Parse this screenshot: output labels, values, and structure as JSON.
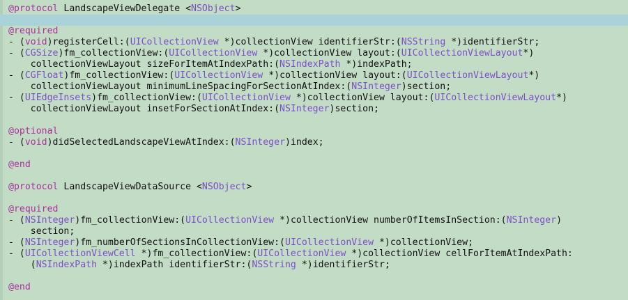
{
  "editor": {
    "current_line_index": 1,
    "colors": {
      "background": "#c3dcc6",
      "current_line": "#a9d3d9",
      "keyword": "#a8329a",
      "type": "#7b4fc4",
      "plain": "#111111"
    },
    "lines": [
      [
        {
          "t": "kw",
          "s": "@protocol"
        },
        {
          "t": "plain",
          "s": " LandscapeViewDelegate <"
        },
        {
          "t": "type",
          "s": "NSObject"
        },
        {
          "t": "plain",
          "s": ">"
        }
      ],
      [],
      [
        {
          "t": "kw",
          "s": "@required"
        }
      ],
      [
        {
          "t": "plain",
          "s": "- ("
        },
        {
          "t": "kw",
          "s": "void"
        },
        {
          "t": "plain",
          "s": ")registerCell:("
        },
        {
          "t": "type",
          "s": "UICollectionView"
        },
        {
          "t": "plain",
          "s": " *)collectionView identifierStr:("
        },
        {
          "t": "type",
          "s": "NSString"
        },
        {
          "t": "plain",
          "s": " *)identifierStr;"
        }
      ],
      [
        {
          "t": "plain",
          "s": "- ("
        },
        {
          "t": "type",
          "s": "CGSize"
        },
        {
          "t": "plain",
          "s": ")fm_collectionView:("
        },
        {
          "t": "type",
          "s": "UICollectionView"
        },
        {
          "t": "plain",
          "s": " *)collectionView layout:("
        },
        {
          "t": "type",
          "s": "UICollectionViewLayout"
        },
        {
          "t": "plain",
          "s": "*)"
        }
      ],
      [
        {
          "t": "plain",
          "s": "    collectionViewLayout sizeForItemAtIndexPath:("
        },
        {
          "t": "type",
          "s": "NSIndexPath"
        },
        {
          "t": "plain",
          "s": " *)indexPath;"
        }
      ],
      [
        {
          "t": "plain",
          "s": "- ("
        },
        {
          "t": "type",
          "s": "CGFloat"
        },
        {
          "t": "plain",
          "s": ")fm_collectionView:("
        },
        {
          "t": "type",
          "s": "UICollectionView"
        },
        {
          "t": "plain",
          "s": " *)collectionView layout:("
        },
        {
          "t": "type",
          "s": "UICollectionViewLayout"
        },
        {
          "t": "plain",
          "s": "*)"
        }
      ],
      [
        {
          "t": "plain",
          "s": "    collectionViewLayout minimumLineSpacingForSectionAtIndex:("
        },
        {
          "t": "type",
          "s": "NSInteger"
        },
        {
          "t": "plain",
          "s": ")section;"
        }
      ],
      [
        {
          "t": "plain",
          "s": "- ("
        },
        {
          "t": "type",
          "s": "UIEdgeInsets"
        },
        {
          "t": "plain",
          "s": ")fm_collectionView:("
        },
        {
          "t": "type",
          "s": "UICollectionView"
        },
        {
          "t": "plain",
          "s": " *)collectionView layout:("
        },
        {
          "t": "type",
          "s": "UICollectionViewLayout"
        },
        {
          "t": "plain",
          "s": "*)"
        }
      ],
      [
        {
          "t": "plain",
          "s": "    collectionViewLayout insetForSectionAtIndex:("
        },
        {
          "t": "type",
          "s": "NSInteger"
        },
        {
          "t": "plain",
          "s": ")section;"
        }
      ],
      [],
      [
        {
          "t": "kw",
          "s": "@optional"
        }
      ],
      [
        {
          "t": "plain",
          "s": "- ("
        },
        {
          "t": "kw",
          "s": "void"
        },
        {
          "t": "plain",
          "s": ")didSelectedLandscapeViewAtIndex:("
        },
        {
          "t": "type",
          "s": "NSInteger"
        },
        {
          "t": "plain",
          "s": ")index;"
        }
      ],
      [],
      [
        {
          "t": "kw",
          "s": "@end"
        }
      ],
      [],
      [
        {
          "t": "kw",
          "s": "@protocol"
        },
        {
          "t": "plain",
          "s": " LandscapeViewDataSource <"
        },
        {
          "t": "type",
          "s": "NSObject"
        },
        {
          "t": "plain",
          "s": ">"
        }
      ],
      [],
      [
        {
          "t": "kw",
          "s": "@required"
        }
      ],
      [
        {
          "t": "plain",
          "s": "- ("
        },
        {
          "t": "type",
          "s": "NSInteger"
        },
        {
          "t": "plain",
          "s": ")fm_collectionView:("
        },
        {
          "t": "type",
          "s": "UICollectionView"
        },
        {
          "t": "plain",
          "s": " *)collectionView numberOfItemsInSection:("
        },
        {
          "t": "type",
          "s": "NSInteger"
        },
        {
          "t": "plain",
          "s": ")"
        }
      ],
      [
        {
          "t": "plain",
          "s": "    section;"
        }
      ],
      [
        {
          "t": "plain",
          "s": "- ("
        },
        {
          "t": "type",
          "s": "NSInteger"
        },
        {
          "t": "plain",
          "s": ")fm_numberOfSectionsInCollectionView:("
        },
        {
          "t": "type",
          "s": "UICollectionView"
        },
        {
          "t": "plain",
          "s": " *)collectionView;"
        }
      ],
      [
        {
          "t": "plain",
          "s": "- ("
        },
        {
          "t": "type",
          "s": "UICollectionViewCell"
        },
        {
          "t": "plain",
          "s": " *)fm_collectionView:("
        },
        {
          "t": "type",
          "s": "UICollectionView"
        },
        {
          "t": "plain",
          "s": " *)collectionView cellForItemAtIndexPath:"
        }
      ],
      [
        {
          "t": "plain",
          "s": "    ("
        },
        {
          "t": "type",
          "s": "NSIndexPath"
        },
        {
          "t": "plain",
          "s": " *)indexPath identifierStr:("
        },
        {
          "t": "type",
          "s": "NSString"
        },
        {
          "t": "plain",
          "s": " *)identifierStr;"
        }
      ],
      [],
      [
        {
          "t": "kw",
          "s": "@end"
        }
      ]
    ]
  }
}
